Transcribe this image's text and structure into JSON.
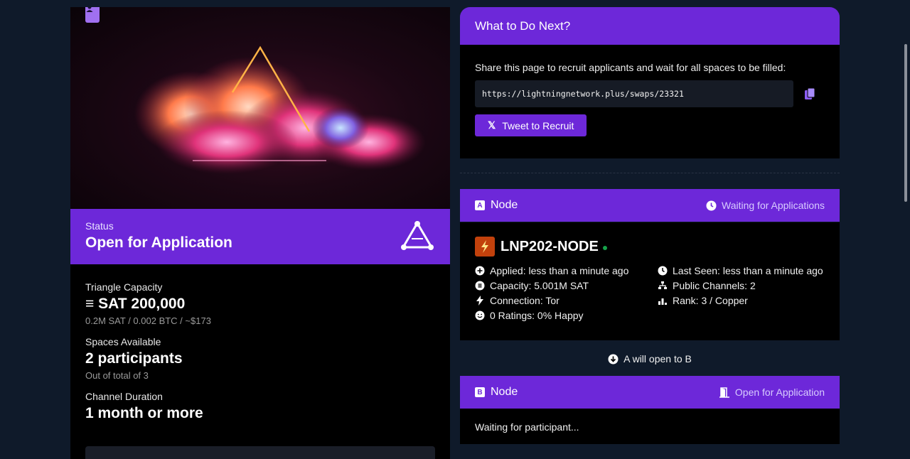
{
  "status": {
    "label": "Status",
    "value": "Open for Application"
  },
  "stats": {
    "capacity_label": "Triangle Capacity",
    "capacity_value": "SAT 200,000",
    "capacity_sub": "0.2M SAT / 0.002 BTC / ~$173",
    "spaces_label": "Spaces Available",
    "spaces_value": "2 participants",
    "spaces_sub": "Out of total of 3",
    "duration_label": "Channel Duration",
    "duration_value": "1 month or more"
  },
  "next": {
    "title": "What to Do Next?",
    "instructions": "Share this page to recruit applicants and wait for all spaces to be filled:",
    "url": "https://lightningnetwork.plus/swaps/23321",
    "tweet_label": "Tweet to Recruit"
  },
  "node_a": {
    "letter": "A",
    "title": "Node",
    "state": "Waiting for Applications",
    "name": "LNP202-NODE",
    "applied": "Applied: less than a minute ago",
    "capacity": "Capacity: 5.001M SAT",
    "connection": "Connection: Tor",
    "ratings": "0 Ratings: 0% Happy",
    "last_seen": "Last Seen: less than a minute ago",
    "public_channels": "Public Channels: 2",
    "rank": "Rank: 3 / Copper"
  },
  "flow_ab": "A will open to B",
  "node_b": {
    "letter": "B",
    "title": "Node",
    "state": "Open for Application",
    "body": "Waiting for participant..."
  },
  "colors": {
    "accent": "#6d28d9",
    "background": "#0f1a2a",
    "online": "#16a34a"
  }
}
